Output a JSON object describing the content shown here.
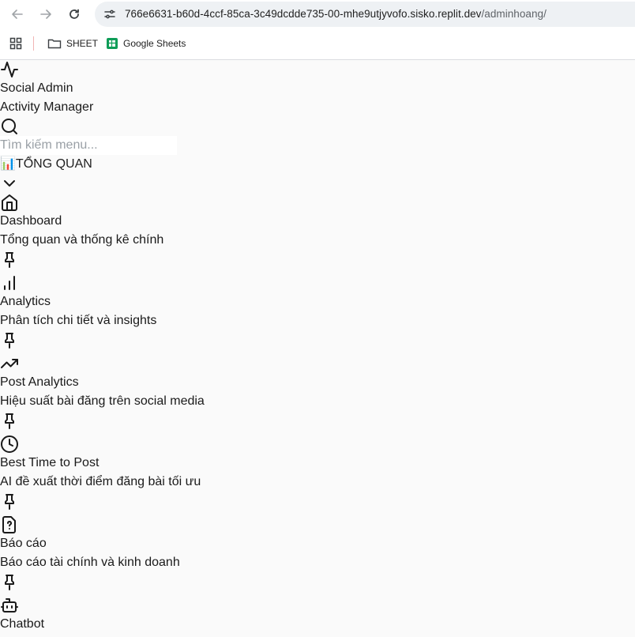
{
  "browser": {
    "url_host": "766e6631-b60d-4ccf-85ca-3c49dcdde735-00-mhe9utjyvofo.sisko.replit.dev",
    "url_path": "/adminhoang/",
    "bookmarks": [
      {
        "label": "SHEET",
        "icon": "folder-icon"
      },
      {
        "label": "Google Sheets",
        "icon": "google-sheets-icon"
      }
    ]
  },
  "brand": {
    "title": "Social Admin",
    "subtitle": "Activity Manager",
    "icon": "activity-icon"
  },
  "search": {
    "placeholder": "Tìm kiếm menu..."
  },
  "section": {
    "emoji": "📊",
    "label": "TỔNG QUAN"
  },
  "menu": [
    {
      "title": "Dashboard",
      "desc": "Tổng quan và thống kê chính",
      "icon": "home-icon"
    },
    {
      "title": "Analytics",
      "desc": "Phân tích chi tiết và insights",
      "icon": "bar-chart-icon"
    },
    {
      "title": "Post Analytics",
      "desc": "Hiệu suất bài đăng trên social media",
      "icon": "trending-up-icon"
    },
    {
      "title": "Best Time to Post",
      "desc": "AI đề xuất thời điểm đăng bài tối ưu",
      "icon": "clock-icon"
    },
    {
      "title": "Báo cáo",
      "desc": "Báo cáo tài chính và kinh doanh",
      "icon": "file-question-icon"
    },
    {
      "title": "Chatbot",
      "desc": "",
      "icon": "bot-icon"
    }
  ]
}
